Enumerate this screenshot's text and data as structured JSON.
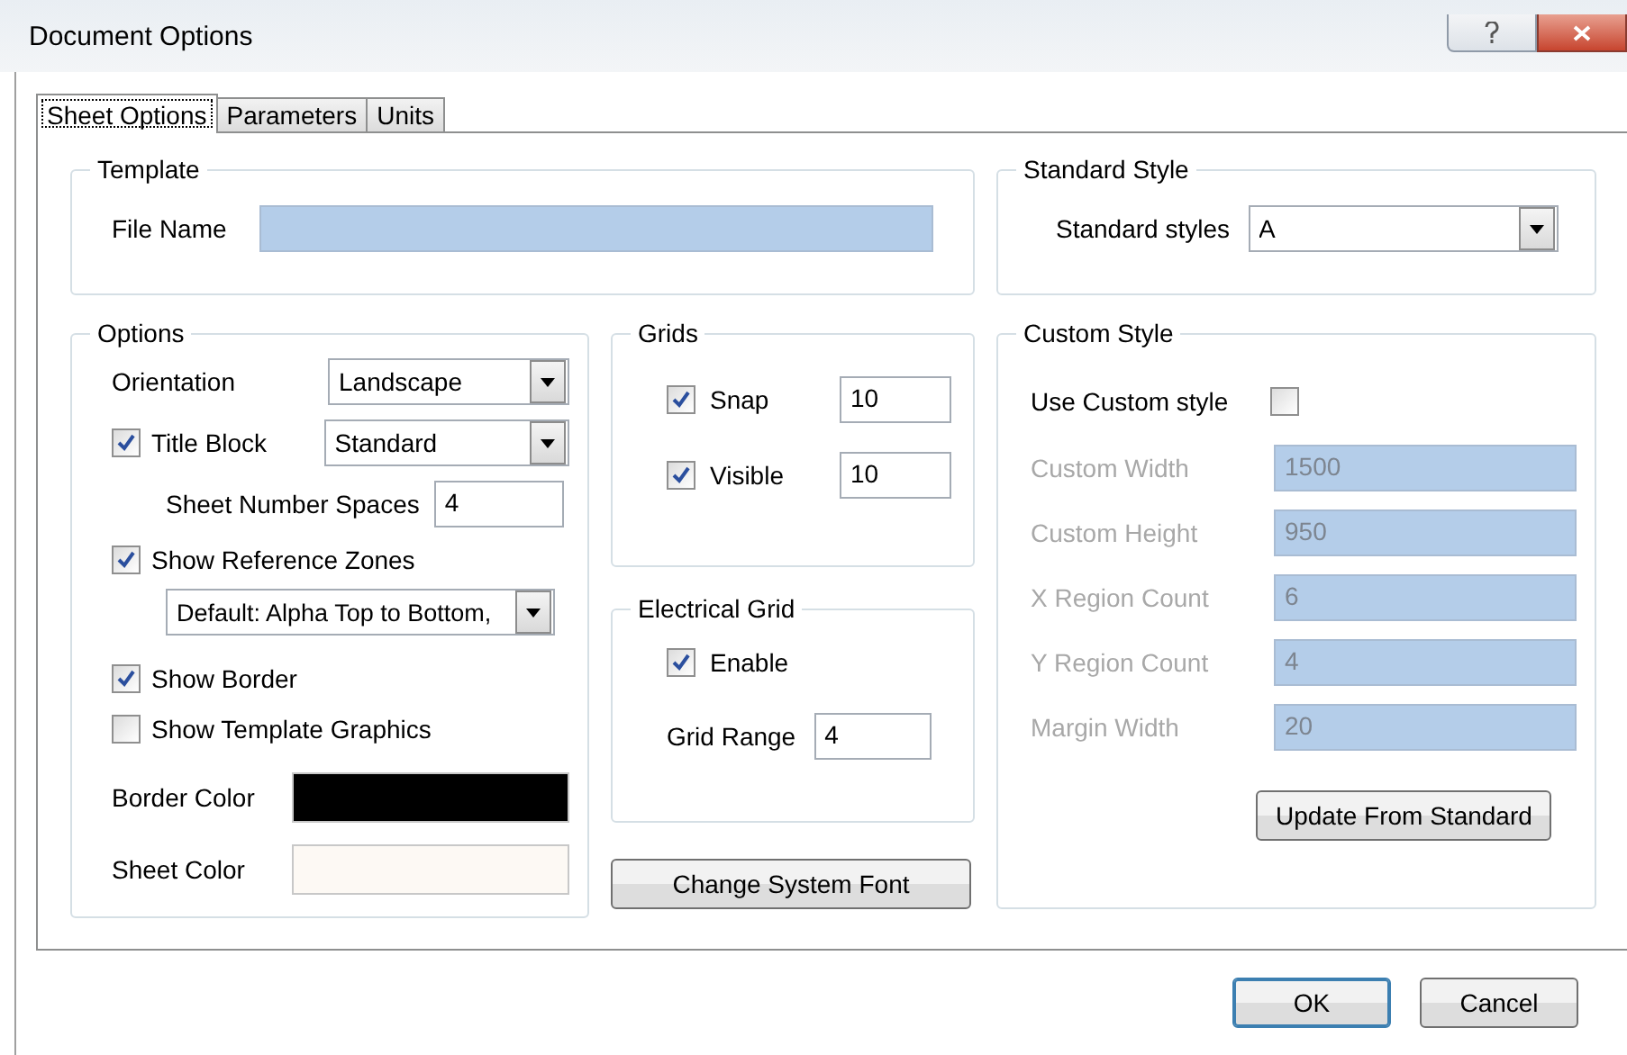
{
  "window": {
    "title": "Document Options"
  },
  "tabs": [
    {
      "label": "Sheet Options",
      "selected": true
    },
    {
      "label": "Parameters",
      "selected": false
    },
    {
      "label": "Units",
      "selected": false
    }
  ],
  "template": {
    "title": "Template",
    "file_name": {
      "label": "File Name",
      "disabled": true
    }
  },
  "standard_style": {
    "title": "Standard Style",
    "label": "Standard styles",
    "value": "A"
  },
  "options": {
    "title": "Options",
    "orientation": {
      "label": "Orientation",
      "value": "Landscape"
    },
    "title_block": {
      "label": "Title Block",
      "checked": true,
      "value": "Standard"
    },
    "sheet_number_spaces": {
      "label": "Sheet Number Spaces",
      "value": "4"
    },
    "reference_zones": {
      "label": "Show Reference Zones",
      "checked": true,
      "value": "Default: Alpha Top to Bottom,"
    },
    "show_border": {
      "label": "Show Border",
      "checked": true
    },
    "show_template_graphics": {
      "label": "Show Template Graphics",
      "checked": false
    },
    "colors": [
      {
        "label": "Border Color",
        "color": "#000000"
      },
      {
        "label": "Sheet Color",
        "color": "#fdf9f4"
      }
    ]
  },
  "grids": {
    "title": "Grids",
    "items": [
      {
        "label": "Snap",
        "checked": true,
        "value": "10"
      },
      {
        "label": "Visible",
        "checked": true,
        "value": "10"
      }
    ]
  },
  "electrical_grid": {
    "title": "Electrical Grid",
    "enable": {
      "label": "Enable",
      "checked": true
    },
    "grid_range": {
      "label": "Grid Range",
      "value": "4"
    }
  },
  "change_font_button": "Change System Font",
  "custom_style": {
    "title": "Custom Style",
    "use_custom": {
      "label": "Use Custom style",
      "checked": false
    },
    "fields": [
      {
        "label": "Custom Width",
        "value": "1500",
        "disabled": true
      },
      {
        "label": "Custom Height",
        "value": "950",
        "disabled": true
      },
      {
        "label": "X Region Count",
        "value": "6",
        "disabled": true
      },
      {
        "label": "Y Region Count",
        "value": "4",
        "disabled": true
      },
      {
        "label": "Margin Width",
        "value": "20",
        "disabled": true
      }
    ],
    "update_button": "Update From Standard"
  },
  "buttons": [
    {
      "label": "OK",
      "default": true
    },
    {
      "label": "Cancel",
      "default": false
    }
  ]
}
